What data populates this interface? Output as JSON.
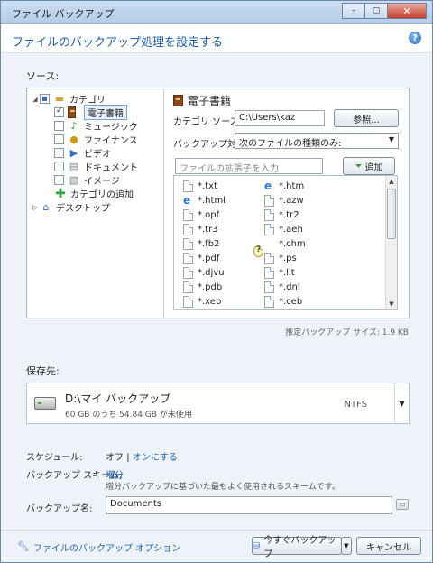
{
  "window": {
    "title": "ファイル バックアップ",
    "minimize": "–",
    "maximize": "▢",
    "close": "✕"
  },
  "header": {
    "title": "ファイルのバックアップ処理を設定する",
    "help": "?"
  },
  "source": {
    "label": "ソース:",
    "tree": {
      "categories": "カテゴリ",
      "items": [
        {
          "label": "電子書籍",
          "icon": "book-icon"
        },
        {
          "label": "ミュージック",
          "icon": "music-note-icon"
        },
        {
          "label": "ファイナンス",
          "icon": "coin-icon"
        },
        {
          "label": "ビデオ",
          "icon": "video-play-icon"
        },
        {
          "label": "ドキュメント",
          "icon": "document-icon"
        },
        {
          "label": "イメージ",
          "icon": "image-icon"
        }
      ],
      "add_category": "カテゴリの追加",
      "desktop": "デスクトップ"
    },
    "detail": {
      "title": "電子書籍",
      "category_source_label": "カテゴリ ソース:",
      "category_source_value": "C:\\Users\\kaz",
      "browse_button": "参照...",
      "backup_target_label": "バックアップ対象:",
      "backup_target_value": "次のファイルの種類のみ:",
      "extension_placeholder": "ファイルの拡張子を入力",
      "add_button": "追加",
      "files_left": [
        "*.txt",
        "*.html",
        "*.opf",
        "*.tr3",
        "*.fb2",
        "*.pdf",
        "*.djvu",
        "*.pdb",
        "*.xeb"
      ],
      "files_right": [
        "*.htm",
        "*.azw",
        "*.tr2",
        "*.aeh",
        "*.chm",
        "*.ps",
        "*.lit",
        "*.dnl",
        "*.ceb"
      ]
    },
    "estimate": "推定バックアップ サイズ: 1.9 KB"
  },
  "destination": {
    "label": "保存先:",
    "name": "D:\\マイ バックアップ",
    "free": "60 GB のうち 54.84 GB が未使用",
    "filesystem": "NTFS"
  },
  "schedule": {
    "label": "スケジュール:",
    "value": "オフ",
    "separator": "|",
    "link": "オンにする"
  },
  "scheme": {
    "label": "バックアップ スキーム:",
    "value": "増分",
    "hint": "増分バックアップに基づいた最もよく使用されるスキームです。"
  },
  "backup_name": {
    "label": "バックアップ名:",
    "value": "Documents"
  },
  "footer": {
    "options_link": "ファイルのバックアップ オプション",
    "backup_now": "今すぐバックアップ",
    "cancel": "キャンセル"
  }
}
